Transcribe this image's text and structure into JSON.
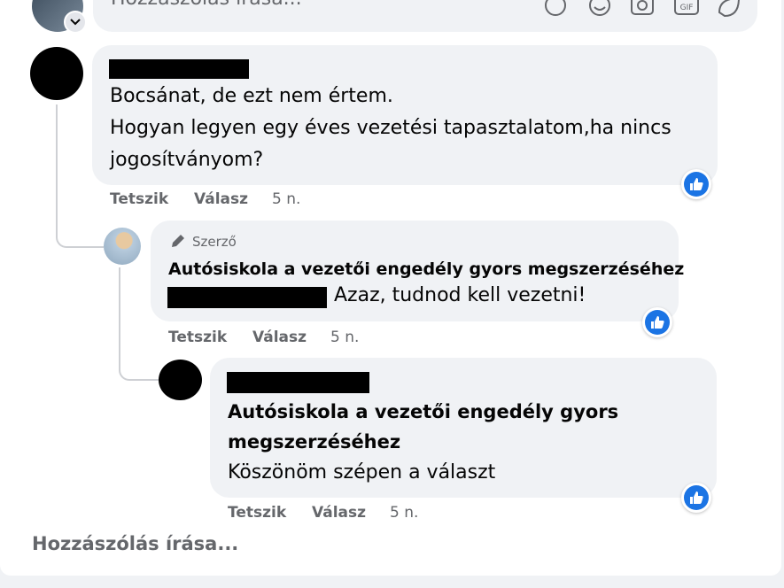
{
  "top_composer": {
    "placeholder": "Hozzászolás írása..."
  },
  "comment1": {
    "lines": [
      "Bocsánat, de ezt nem értem.",
      "Hogyan legyen egy éves vezetési tapasztalatom,ha nincs",
      "jogosítványom?"
    ],
    "like_label": "Tetszik",
    "reply_label": "Válasz",
    "time": "5 n."
  },
  "reply1": {
    "badge": "Szerző",
    "author": "Autósiskola a vezetői engedély gyors megszerzéséhez",
    "text": "Azaz, tudnod kell vezetni!",
    "like_label": "Tetszik",
    "reply_label": "Válasz",
    "time": "5 n."
  },
  "reply2": {
    "mention_lines": [
      "Autósiskola a vezetői engedély gyors",
      "megszerzéséhez"
    ],
    "text": "Köszönöm szépen a választ",
    "like_label": "Tetszik",
    "reply_label": "Válasz",
    "time": "5 n."
  },
  "bottom_composer": {
    "placeholder": "Hozzászólás írása..."
  },
  "icons": [
    "chevron-down-icon",
    "sticker-icon",
    "emoji-icon",
    "camera-icon",
    "gif-icon",
    "avatar-sticker-icon",
    "pencil-icon",
    "like-icon"
  ],
  "colors": {
    "accent": "#1b74e4",
    "bubble": "#f0f2f5",
    "secondary_text": "#65676b"
  }
}
